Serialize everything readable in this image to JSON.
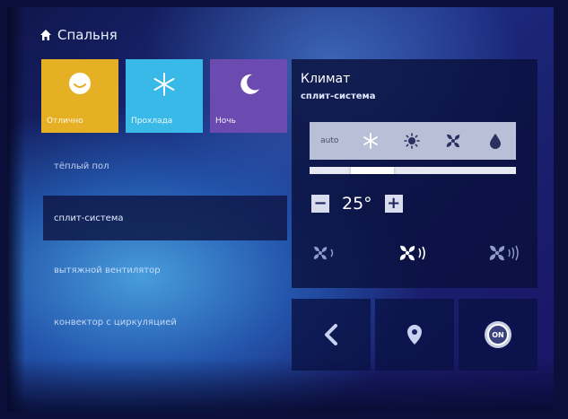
{
  "header": {
    "title": "Спальня",
    "icon": "home-icon"
  },
  "scenes": [
    {
      "label": "Отлично",
      "icon": "smiley-icon",
      "color": "#e6b024"
    },
    {
      "label": "Прохлада",
      "icon": "snowflake-icon",
      "color": "#39b9e8"
    },
    {
      "label": "Ночь",
      "icon": "moon-icon",
      "color": "#6c4bb0"
    }
  ],
  "devices": [
    {
      "label": "тёплый пол",
      "active": false
    },
    {
      "label": "сплит-система",
      "active": true
    },
    {
      "label": "вытяжной вентилятор",
      "active": false
    },
    {
      "label": "конвектор с циркуляцией",
      "active": false
    }
  ],
  "climate": {
    "title": "Климат",
    "subtitle": "сплит-система",
    "modes": {
      "auto_label": "auto",
      "icons": [
        "snowflake-icon",
        "sun-icon",
        "fan-icon",
        "drop-icon"
      ],
      "selected_fraction": [
        0.2,
        0.41
      ]
    },
    "temperature": {
      "value": "25°",
      "minus": "−",
      "plus": "+"
    },
    "fan_speeds": [
      "fan-low-icon",
      "fan-medium-icon",
      "fan-high-icon"
    ],
    "fan_selected_index": 1
  },
  "bottom_buttons": {
    "back_icon": "chevron-left-icon",
    "location_icon": "location-pin-icon",
    "power_label": "ON"
  }
}
